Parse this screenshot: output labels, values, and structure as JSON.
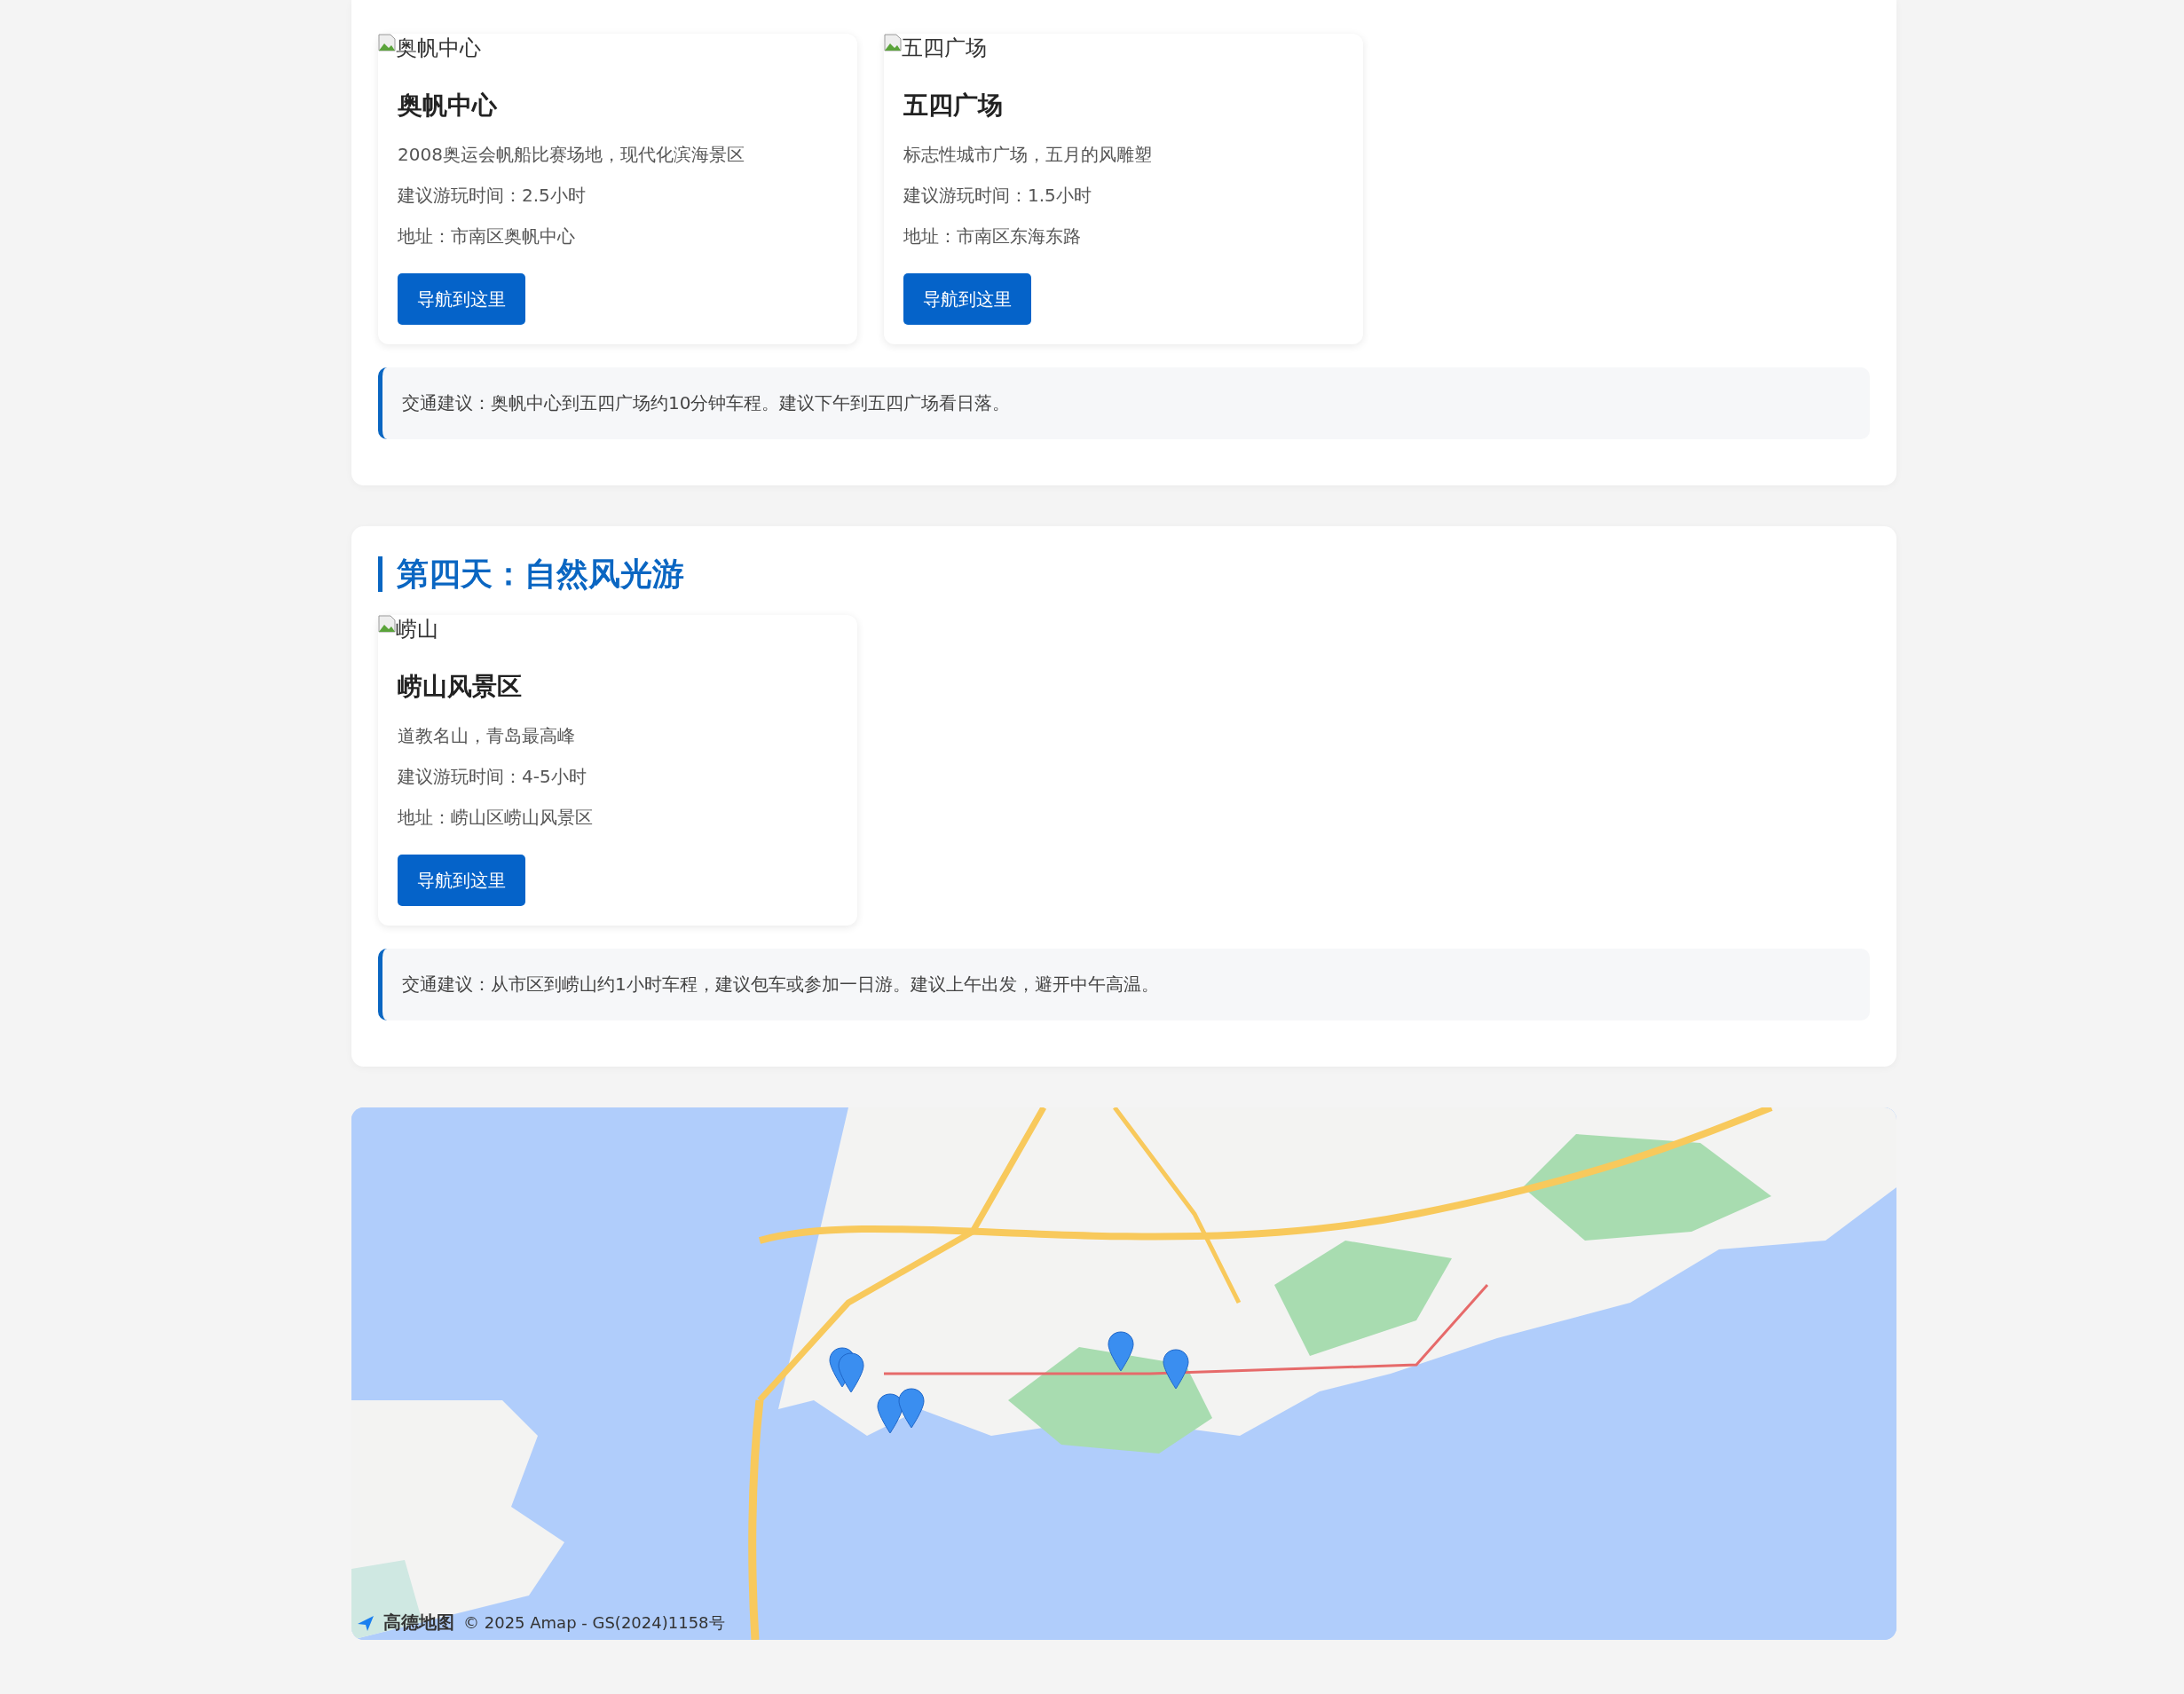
{
  "days": [
    {
      "spots": [
        {
          "image_alt": "奥帆中心",
          "name": "奥帆中心",
          "description": "2008奥运会帆船比赛场地，现代化滨海景区",
          "duration": "建议游玩时间：2.5小时",
          "address": "地址：市南区奥帆中心",
          "button": "导航到这里"
        },
        {
          "image_alt": "五四广场",
          "name": "五四广场",
          "description": "标志性城市广场，五月的风雕塑",
          "duration": "建议游玩时间：1.5小时",
          "address": "地址：市南区东海东路",
          "button": "导航到这里"
        }
      ],
      "tip": "交通建议：奥帆中心到五四广场约10分钟车程。建议下午到五四广场看日落。"
    },
    {
      "title": "第四天：自然风光游",
      "spots": [
        {
          "image_alt": "崂山",
          "name": "崂山风景区",
          "description": "道教名山，青岛最高峰",
          "duration": "建议游玩时间：4-5小时",
          "address": "地址：崂山区崂山风景区",
          "button": "导航到这里"
        }
      ],
      "tip": "交通建议：从市区到崂山约1小时车程，建议包车或参加一日游。建议上午出发，避开中午高温。"
    }
  ],
  "map": {
    "kind": "picture",
    "logo_text": "高德地图",
    "copyright": "© 2025 Amap - GS(2024)1158号"
  }
}
